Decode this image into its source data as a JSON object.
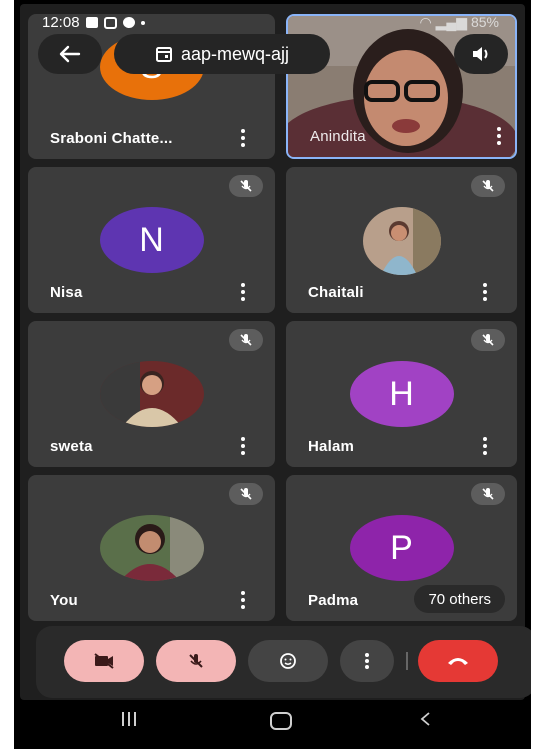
{
  "status_bar": {
    "time": "12:08",
    "battery": "85%"
  },
  "header": {
    "meeting_code": "aap-mewq-ajj"
  },
  "participants": [
    {
      "name": "Sraboni Chatte...",
      "initial": "S",
      "color": "#e8710a",
      "type": "avatar",
      "muted": false
    },
    {
      "name": "Anindita",
      "type": "video",
      "muted": false,
      "active_speaker": true
    },
    {
      "name": "Nisa",
      "initial": "N",
      "color": "#5e35b1",
      "type": "avatar",
      "muted": true
    },
    {
      "name": "Chaitali",
      "type": "photo",
      "muted": true
    },
    {
      "name": "sweta",
      "type": "photo",
      "muted": true
    },
    {
      "name": "Halam",
      "initial": "H",
      "color": "#a142c4",
      "type": "avatar",
      "muted": true
    },
    {
      "name": "You",
      "type": "photo",
      "muted": true
    },
    {
      "name": "Padma",
      "initial": "P",
      "color": "#8e24aa",
      "type": "avatar",
      "muted": true
    }
  ],
  "others_label": "70 others",
  "controls": {
    "camera_color": "#f3b5b5",
    "mic_color": "#f3b5b5",
    "end_call_color": "#e53935"
  }
}
